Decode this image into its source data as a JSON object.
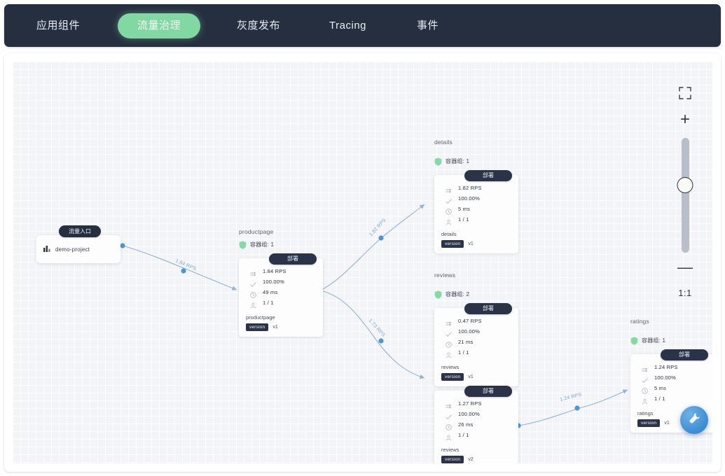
{
  "nav": {
    "items": [
      {
        "label": "应用组件",
        "active": false
      },
      {
        "label": "流量治理",
        "active": true
      },
      {
        "label": "灰度发布",
        "active": false
      },
      {
        "label": "Tracing",
        "active": false
      },
      {
        "label": "事件",
        "active": false
      }
    ]
  },
  "graph": {
    "entry": {
      "tag": "流量入口",
      "name": "demo-project",
      "icon": "chart-icon"
    },
    "deploy_label": "部署",
    "pods_label_prefix": "容器组:",
    "version_key": "version",
    "metric_icons": [
      "rps-icon",
      "success-rate-icon",
      "latency-icon",
      "instances-icon"
    ],
    "nodes": [
      {
        "id": "productpage",
        "title": "productpage",
        "pods": "容器组: 1",
        "deploy": "部署",
        "metrics": [
          {
            "icon": "rps-icon",
            "value": "1.84 RPS"
          },
          {
            "icon": "success-rate-icon",
            "value": "100.00%"
          },
          {
            "icon": "latency-icon",
            "value": "49 ms"
          },
          {
            "icon": "instances-icon",
            "value": "1 / 1"
          }
        ],
        "service": "productpage",
        "version_key": "version",
        "version_value": "v1"
      },
      {
        "id": "details",
        "title": "details",
        "pods": "容器组: 1",
        "deploy": "部署",
        "metrics": [
          {
            "icon": "rps-icon",
            "value": "1.82 RPS"
          },
          {
            "icon": "success-rate-icon",
            "value": "100.00%"
          },
          {
            "icon": "latency-icon",
            "value": "5 ms"
          },
          {
            "icon": "instances-icon",
            "value": "1 / 1"
          }
        ],
        "service": "details",
        "version_key": "version",
        "version_value": "v1"
      },
      {
        "id": "reviews-v1",
        "title": "reviews",
        "pods": "容器组: 2",
        "deploy": "部署",
        "metrics": [
          {
            "icon": "rps-icon",
            "value": "0.47 RPS"
          },
          {
            "icon": "success-rate-icon",
            "value": "100.00%"
          },
          {
            "icon": "latency-icon",
            "value": "21 ms"
          },
          {
            "icon": "instances-icon",
            "value": "1 / 1"
          }
        ],
        "service": "reviews",
        "version_key": "version",
        "version_value": "v1"
      },
      {
        "id": "reviews-v2",
        "title": "",
        "pods": "",
        "deploy": "部署",
        "metrics": [
          {
            "icon": "rps-icon",
            "value": "1.27 RPS"
          },
          {
            "icon": "success-rate-icon",
            "value": "100.00%"
          },
          {
            "icon": "latency-icon",
            "value": "26 ms"
          },
          {
            "icon": "instances-icon",
            "value": "1 / 1"
          }
        ],
        "service": "reviews",
        "version_key": "version",
        "version_value": "v2"
      },
      {
        "id": "ratings",
        "title": "ratings",
        "pods": "容器组: 1",
        "deploy": "部署",
        "metrics": [
          {
            "icon": "rps-icon",
            "value": "1.24 RPS"
          },
          {
            "icon": "success-rate-icon",
            "value": "100.00%"
          },
          {
            "icon": "latency-icon",
            "value": "5 ms"
          },
          {
            "icon": "instances-icon",
            "value": "1 / 1"
          }
        ],
        "service": "ratings",
        "version_key": "version",
        "version_value": "v1"
      }
    ],
    "edges": [
      {
        "from": "entry",
        "to": "productpage",
        "label": "1.84 RPS"
      },
      {
        "from": "productpage",
        "to": "details",
        "label": "1.82 RPS"
      },
      {
        "from": "productpage",
        "to": "reviews",
        "label": "1.73 RPS"
      },
      {
        "from": "reviews-v2",
        "to": "ratings",
        "label": "1.24 RPS"
      }
    ]
  },
  "controls": {
    "fullscreen": "fullscreen-icon",
    "zoom_in": "+",
    "zoom_out": "—",
    "ratio": "1:1",
    "fab": "tool-icon"
  }
}
